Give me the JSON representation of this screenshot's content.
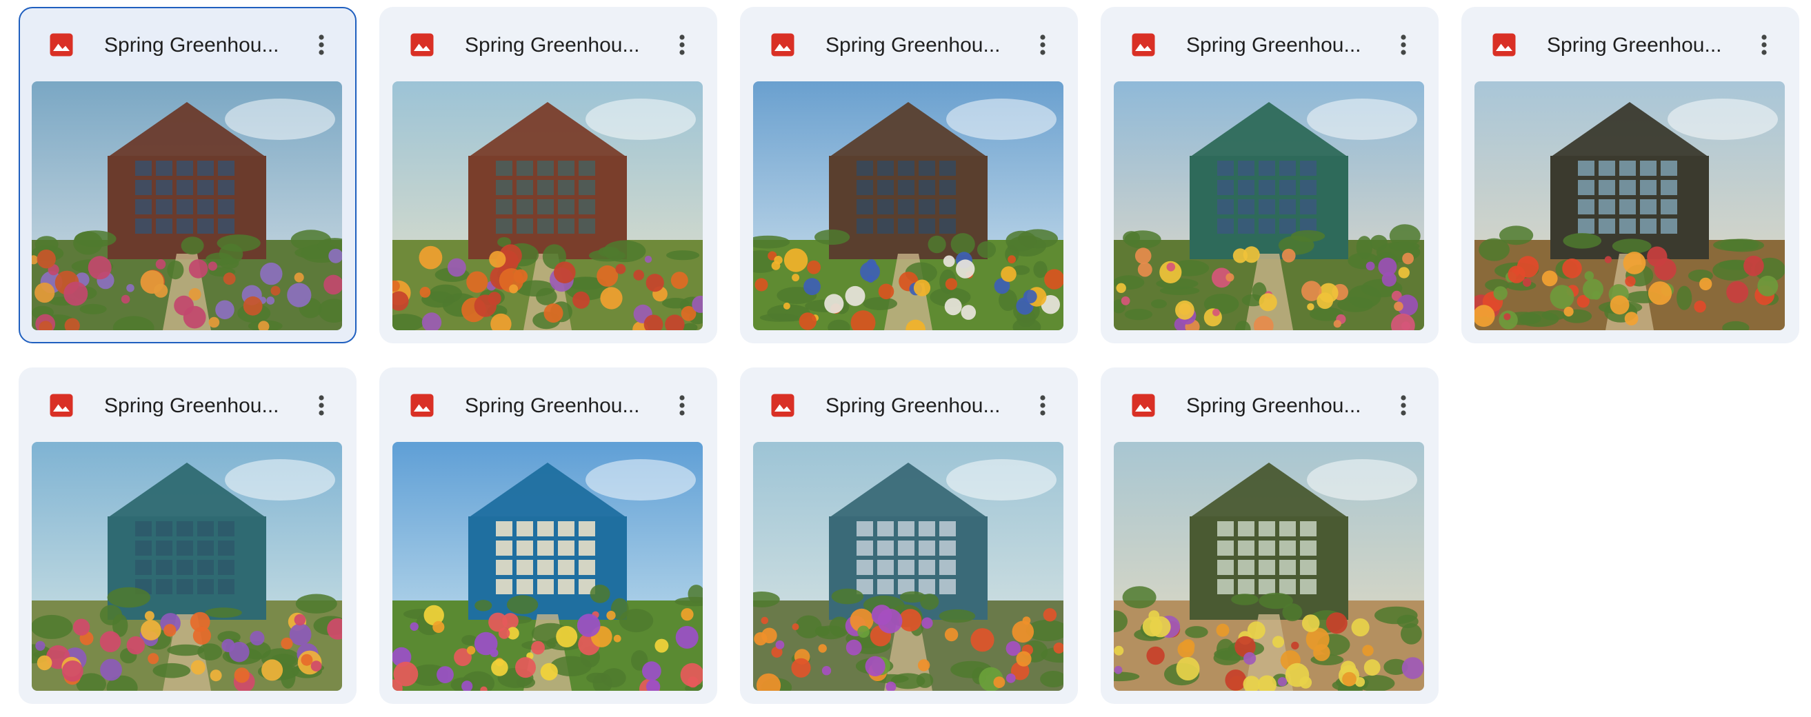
{
  "colors": {
    "card_background": "#eef2f8",
    "selected_border": "#1f5fbf",
    "image_icon": "#d93025",
    "title_text": "#1f1f1f",
    "more_icon": "#444746"
  },
  "file_icon_name": "image-file-icon",
  "more_icon_name": "more-vert-icon",
  "files": [
    {
      "title": "Spring Greenhou...",
      "selected": true,
      "scene": "brick-house-round-window"
    },
    {
      "title": "Spring Greenhou...",
      "selected": false,
      "scene": "glass-greenhouse-orange-flowers"
    },
    {
      "title": "Spring Greenhou...",
      "selected": false,
      "scene": "ivy-covered-glasshouse"
    },
    {
      "title": "Spring Greenhou...",
      "selected": false,
      "scene": "pink-roof-green-house"
    },
    {
      "title": "Spring Greenhou...",
      "selected": false,
      "scene": "greenhouse-interior-wood-path"
    },
    {
      "title": "Spring Greenhou...",
      "selected": false,
      "scene": "teal-greenhouse-windows"
    },
    {
      "title": "Spring Greenhou...",
      "selected": false,
      "scene": "blue-cottage-pink-flower"
    },
    {
      "title": "Spring Greenhou...",
      "selected": false,
      "scene": "greenhouse-interior-round-mirror"
    },
    {
      "title": "Spring Greenhou...",
      "selected": false,
      "scene": "greenhouse-interior-red-chair"
    }
  ]
}
